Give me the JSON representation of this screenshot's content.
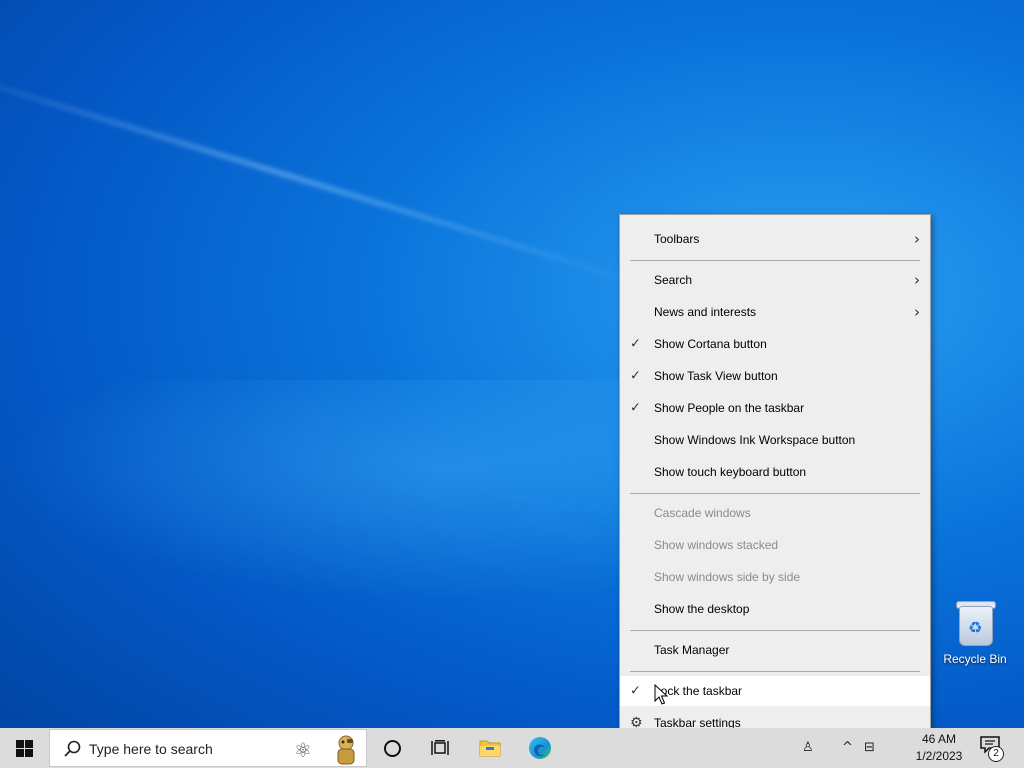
{
  "desktop": {
    "icons": [
      {
        "label": "Recycle Bin",
        "icon": "recycle-bin-icon"
      }
    ]
  },
  "context_menu": {
    "items": [
      {
        "label": "Toolbars",
        "checked": false,
        "submenu": true,
        "disabled": false
      },
      {
        "label": "Search",
        "checked": false,
        "submenu": true,
        "disabled": false
      },
      {
        "label": "News and interests",
        "checked": false,
        "submenu": true,
        "disabled": false
      },
      {
        "label": "Show Cortana button",
        "checked": true,
        "submenu": false,
        "disabled": false
      },
      {
        "label": "Show Task View button",
        "checked": true,
        "submenu": false,
        "disabled": false
      },
      {
        "label": "Show People on the taskbar",
        "checked": true,
        "submenu": false,
        "disabled": false
      },
      {
        "label": "Show Windows Ink Workspace button",
        "checked": false,
        "submenu": false,
        "disabled": false
      },
      {
        "label": "Show touch keyboard button",
        "checked": false,
        "submenu": false,
        "disabled": false
      },
      {
        "label": "Cascade windows",
        "checked": false,
        "submenu": false,
        "disabled": true
      },
      {
        "label": "Show windows stacked",
        "checked": false,
        "submenu": false,
        "disabled": true
      },
      {
        "label": "Show windows side by side",
        "checked": false,
        "submenu": false,
        "disabled": true
      },
      {
        "label": "Show the desktop",
        "checked": false,
        "submenu": false,
        "disabled": false
      },
      {
        "label": "Task Manager",
        "checked": false,
        "submenu": false,
        "disabled": false
      },
      {
        "label": "Lock the taskbar",
        "checked": true,
        "submenu": false,
        "disabled": false,
        "hovered": true
      },
      {
        "label": "Taskbar settings",
        "checked": false,
        "submenu": false,
        "disabled": false,
        "icon": "gear-icon"
      }
    ],
    "check_glyph": "✓",
    "arrow_glyph": "›"
  },
  "taskbar": {
    "search_placeholder": "Type here to search",
    "pinned": [
      "cortana-icon",
      "task-view-icon",
      "file-explorer-icon",
      "edge-icon"
    ],
    "clock_time": "46 AM",
    "clock_date": "1/2/2023",
    "notification_count": "2",
    "tray_glyphs": {
      "people": "♙",
      "chevron": "^",
      "network": "⊟"
    }
  }
}
